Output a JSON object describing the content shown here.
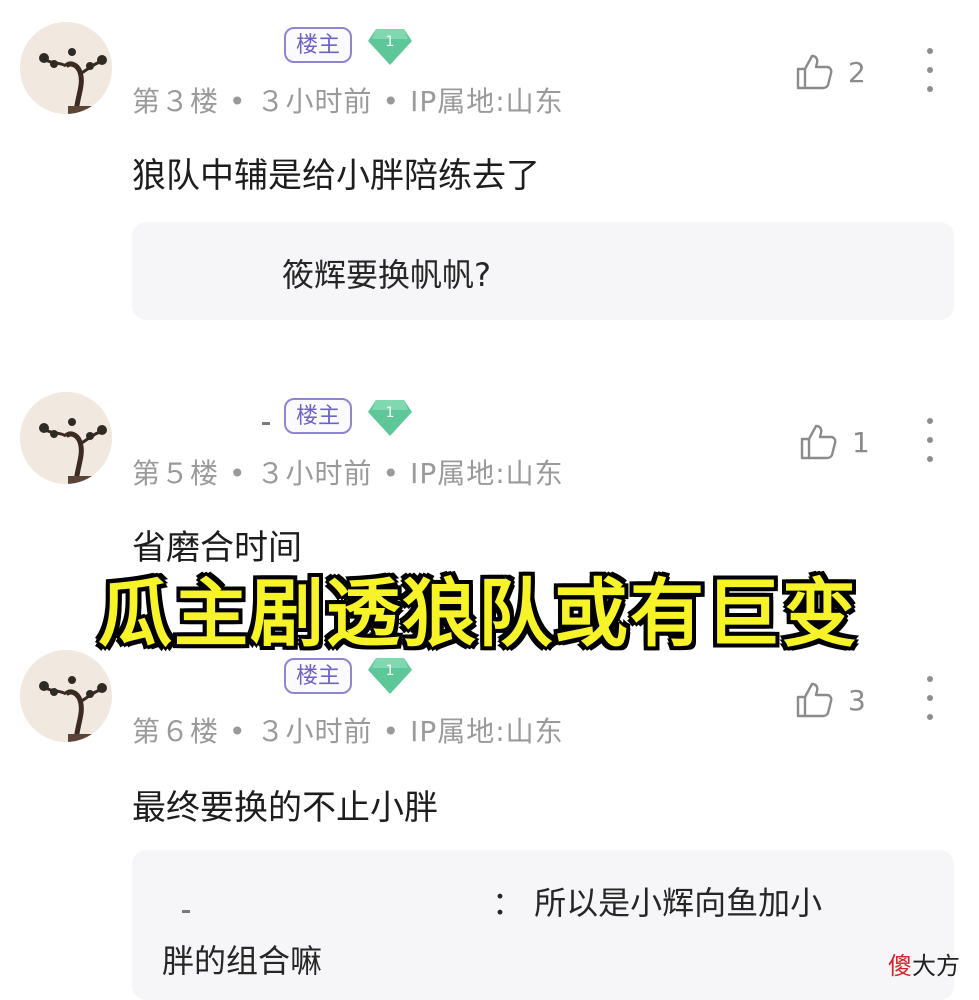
{
  "overlay_title": "瓜主剧透狼队或有巨变",
  "watermark": {
    "char1": "傻",
    "rest": "大方"
  },
  "comments": [
    {
      "badge": "楼主",
      "level": "1",
      "meta": {
        "floor": "第３楼",
        "time": "３小时前",
        "ip": "IP属地:山东"
      },
      "likes": "2",
      "text": "狼队中辅是给小胖陪练去了",
      "reply": "筱辉要换帆帆?"
    },
    {
      "badge": "楼主",
      "level": "1",
      "meta": {
        "floor": "第５楼",
        "time": "３小时前",
        "ip": "IP属地:山东"
      },
      "likes": "1",
      "text": "省磨合时间"
    },
    {
      "badge": "楼主",
      "level": "1",
      "meta": {
        "floor": "第６楼",
        "time": "３小时前",
        "ip": "IP属地:山东"
      },
      "likes": "3",
      "text": "最终要换的不止小胖",
      "reply_line1": "：  所以是小辉向鱼加小",
      "reply_line2": "胖的组合嘛"
    }
  ],
  "icons": {
    "like": "thumbs-up-icon",
    "more": "more-vertical-icon",
    "level": "diamond-level-icon",
    "avatar": "bonsai-avatar"
  },
  "colors": {
    "overlay_text": "#f7f329",
    "badge_border": "#8f86d3",
    "level_gem": "#5ec79a",
    "meta_text": "#9a9a9a",
    "reply_bg": "#f6f6f8"
  }
}
